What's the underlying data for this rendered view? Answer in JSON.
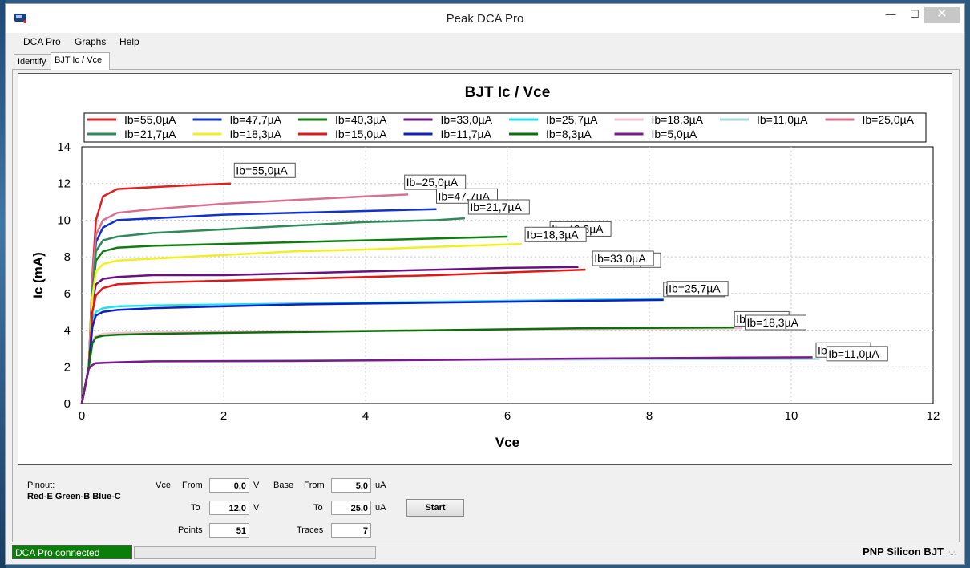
{
  "window": {
    "title": "Peak DCA Pro",
    "minimize": "—",
    "maximize": "☐",
    "close": "✕"
  },
  "menu": [
    "DCA Pro",
    "Graphs",
    "Help"
  ],
  "tabs": [
    {
      "label": "Identify"
    },
    {
      "label": "BJT Ic / Vce",
      "active": true
    }
  ],
  "chart_data": {
    "type": "line",
    "title": "BJT Ic / Vce",
    "xlabel": "Vce",
    "ylabel": "Ic (mA)",
    "xlim": [
      0,
      12
    ],
    "ylim": [
      0,
      14
    ],
    "xticks": [
      0,
      2,
      4,
      6,
      8,
      10,
      12
    ],
    "yticks": [
      0,
      2,
      4,
      6,
      8,
      10,
      12,
      14
    ],
    "grid": true,
    "legend_position": "top",
    "series": [
      {
        "name": "Ib=55,0µA",
        "color": "#e02020",
        "points": [
          [
            0,
            0
          ],
          [
            0.1,
            2.0
          ],
          [
            0.15,
            7.0
          ],
          [
            0.2,
            10.0
          ],
          [
            0.3,
            11.3
          ],
          [
            0.5,
            11.7
          ],
          [
            1.0,
            11.8
          ],
          [
            1.5,
            11.9
          ],
          [
            2.1,
            12.0
          ]
        ]
      },
      {
        "name": "Ib=47,7µA",
        "color": "#1030d0",
        "points": [
          [
            0,
            0
          ],
          [
            0.1,
            2.0
          ],
          [
            0.15,
            6.5
          ],
          [
            0.2,
            8.8
          ],
          [
            0.3,
            9.6
          ],
          [
            0.5,
            10.0
          ],
          [
            1,
            10.1
          ],
          [
            2,
            10.3
          ],
          [
            3,
            10.4
          ],
          [
            4,
            10.5
          ],
          [
            5,
            10.6
          ]
        ]
      },
      {
        "name": "Ib=40,3µA",
        "color": "#0e7d0e",
        "points": [
          [
            0,
            0
          ],
          [
            0.1,
            2.0
          ],
          [
            0.15,
            6.0
          ],
          [
            0.2,
            7.8
          ],
          [
            0.3,
            8.3
          ],
          [
            0.5,
            8.5
          ],
          [
            1,
            8.6
          ],
          [
            2,
            8.7
          ],
          [
            3,
            8.8
          ],
          [
            4,
            8.9
          ],
          [
            5,
            9.0
          ],
          [
            6,
            9.1
          ]
        ]
      },
      {
        "name": "Ib=33,0µA",
        "color": "#6a1080",
        "points": [
          [
            0,
            0
          ],
          [
            0.1,
            2.0
          ],
          [
            0.15,
            5.5
          ],
          [
            0.2,
            6.5
          ],
          [
            0.3,
            6.8
          ],
          [
            0.5,
            6.9
          ],
          [
            1,
            7.0
          ],
          [
            2,
            7.0
          ],
          [
            3,
            7.1
          ],
          [
            4,
            7.2
          ],
          [
            5,
            7.3
          ],
          [
            6,
            7.4
          ],
          [
            7,
            7.45
          ]
        ]
      },
      {
        "name": "Ib=25,7µA",
        "color": "#20e0f0",
        "points": [
          [
            0,
            0
          ],
          [
            0.1,
            2.0
          ],
          [
            0.15,
            4.6
          ],
          [
            0.2,
            5.0
          ],
          [
            0.3,
            5.2
          ],
          [
            0.5,
            5.3
          ],
          [
            1,
            5.35
          ],
          [
            2,
            5.4
          ],
          [
            3,
            5.45
          ],
          [
            4,
            5.5
          ],
          [
            5,
            5.55
          ],
          [
            6,
            5.6
          ],
          [
            7,
            5.65
          ],
          [
            8.2,
            5.7
          ]
        ]
      },
      {
        "name": "Ib=18,3µA",
        "color": "#f5c0d0",
        "points": [
          [
            0,
            0
          ],
          [
            0.1,
            2.0
          ],
          [
            0.15,
            3.4
          ],
          [
            0.2,
            3.7
          ],
          [
            0.3,
            3.8
          ],
          [
            0.5,
            3.85
          ],
          [
            1,
            3.9
          ],
          [
            3,
            3.95
          ],
          [
            5,
            4.0
          ],
          [
            7,
            4.05
          ],
          [
            9.3,
            4.1
          ]
        ]
      },
      {
        "name": "Ib=11,0µA",
        "color": "#a8d8d8",
        "points": [
          [
            0,
            0
          ],
          [
            0.1,
            1.9
          ],
          [
            0.15,
            2.1
          ],
          [
            0.2,
            2.2
          ],
          [
            0.5,
            2.25
          ],
          [
            1,
            2.3
          ],
          [
            3,
            2.35
          ],
          [
            5,
            2.38
          ],
          [
            7,
            2.4
          ],
          [
            9,
            2.42
          ],
          [
            10.4,
            2.43
          ]
        ]
      },
      {
        "name": "Ib=25,0µA",
        "color": "#d87090",
        "points": [
          [
            0,
            0
          ],
          [
            0.1,
            2.0
          ],
          [
            0.15,
            6.8
          ],
          [
            0.2,
            9.2
          ],
          [
            0.3,
            10.0
          ],
          [
            0.5,
            10.4
          ],
          [
            1,
            10.6
          ],
          [
            2,
            10.9
          ],
          [
            3,
            11.1
          ],
          [
            4,
            11.3
          ],
          [
            4.6,
            11.4
          ]
        ]
      },
      {
        "name": "Ib=21,7µA",
        "color": "#2e8a5a",
        "points": [
          [
            0,
            0
          ],
          [
            0.1,
            2.0
          ],
          [
            0.15,
            6.2
          ],
          [
            0.2,
            8.3
          ],
          [
            0.3,
            8.9
          ],
          [
            0.5,
            9.1
          ],
          [
            1,
            9.3
          ],
          [
            2,
            9.5
          ],
          [
            3,
            9.7
          ],
          [
            4,
            9.9
          ],
          [
            5,
            10.0
          ],
          [
            5.4,
            10.1
          ]
        ]
      },
      {
        "name": "Ib=18,3µA",
        "color": "#f0f020",
        "points": [
          [
            0,
            0
          ],
          [
            0.1,
            2.0
          ],
          [
            0.15,
            5.8
          ],
          [
            0.2,
            7.2
          ],
          [
            0.3,
            7.6
          ],
          [
            0.5,
            7.8
          ],
          [
            1,
            7.9
          ],
          [
            2,
            8.1
          ],
          [
            3,
            8.3
          ],
          [
            4,
            8.4
          ],
          [
            5,
            8.55
          ],
          [
            6.2,
            8.7
          ]
        ]
      },
      {
        "name": "Ib=15,0µA",
        "color": "#e01818",
        "points": [
          [
            0,
            0
          ],
          [
            0.1,
            2.0
          ],
          [
            0.15,
            5.0
          ],
          [
            0.2,
            5.9
          ],
          [
            0.3,
            6.3
          ],
          [
            0.5,
            6.5
          ],
          [
            1,
            6.6
          ],
          [
            2,
            6.7
          ],
          [
            3,
            6.8
          ],
          [
            4,
            6.9
          ],
          [
            5,
            7.0
          ],
          [
            6,
            7.15
          ],
          [
            7.1,
            7.3
          ]
        ]
      },
      {
        "name": "Ib=11,7µA",
        "color": "#1020c0",
        "points": [
          [
            0,
            0
          ],
          [
            0.1,
            2.0
          ],
          [
            0.15,
            4.2
          ],
          [
            0.2,
            4.8
          ],
          [
            0.3,
            5.0
          ],
          [
            0.5,
            5.1
          ],
          [
            1,
            5.2
          ],
          [
            2,
            5.3
          ],
          [
            3,
            5.4
          ],
          [
            4,
            5.45
          ],
          [
            5,
            5.5
          ],
          [
            6,
            5.55
          ],
          [
            7,
            5.6
          ],
          [
            8.2,
            5.65
          ]
        ]
      },
      {
        "name": "Ib=8,3µA",
        "color": "#0a700a",
        "points": [
          [
            0,
            0
          ],
          [
            0.1,
            2.0
          ],
          [
            0.15,
            3.3
          ],
          [
            0.2,
            3.6
          ],
          [
            0.3,
            3.7
          ],
          [
            0.5,
            3.75
          ],
          [
            1,
            3.8
          ],
          [
            3,
            3.9
          ],
          [
            5,
            4.0
          ],
          [
            7,
            4.1
          ],
          [
            9.2,
            4.15
          ]
        ]
      },
      {
        "name": "Ib=5,0µA",
        "color": "#7a1a8a",
        "points": [
          [
            0,
            0
          ],
          [
            0.1,
            1.9
          ],
          [
            0.15,
            2.1
          ],
          [
            0.2,
            2.2
          ],
          [
            0.5,
            2.25
          ],
          [
            1,
            2.3
          ],
          [
            3,
            2.32
          ],
          [
            5,
            2.38
          ],
          [
            7,
            2.45
          ],
          [
            9,
            2.5
          ],
          [
            10.3,
            2.52
          ]
        ]
      }
    ],
    "annotations": [
      {
        "text": "Ib=55,0µA",
        "x": 2.15,
        "y": 12.5
      },
      {
        "text": "Ib=25,0µA",
        "x": 4.55,
        "y": 11.85
      },
      {
        "text": "Ib=47,7µA",
        "x": 5.0,
        "y": 11.1
      },
      {
        "text": "Ib=21,7µA",
        "x": 5.45,
        "y": 10.5
      },
      {
        "text": "Ib=40,3µA",
        "x": 6.6,
        "y": 9.3
      },
      {
        "text": "Ib=18,3µA",
        "x": 6.25,
        "y": 9.0
      },
      {
        "text": "Ib=15,0µA",
        "x": 7.3,
        "y": 7.6
      },
      {
        "text": "Ib=33,0µA",
        "x": 7.2,
        "y": 7.7
      },
      {
        "text": "Ib=11,7µA",
        "x": 8.2,
        "y": 6.0
      },
      {
        "text": "Ib=25,7µA",
        "x": 8.25,
        "y": 6.05
      },
      {
        "text": "Ib=8,3µA",
        "x": 9.2,
        "y": 4.4
      },
      {
        "text": "Ib=18,3µA",
        "x": 9.35,
        "y": 4.2
      },
      {
        "text": "Ib=5,0µA",
        "x": 10.35,
        "y": 2.7
      },
      {
        "text": "Ib=11,0µA",
        "x": 10.5,
        "y": 2.5
      }
    ]
  },
  "controls": {
    "pinout_label": "Pinout:",
    "pinout_value": "Red-E Green-B Blue-C",
    "vce_label": "Vce",
    "base_label": "Base",
    "from_label": "From",
    "to_label": "To",
    "points_label": "Points",
    "traces_label": "Traces",
    "vce_from": "0,0",
    "vce_to": "12,0",
    "vce_unit": "V",
    "base_from": "5,0",
    "base_to": "25,0",
    "base_unit": "uA",
    "points": "51",
    "traces": "7",
    "start_button": "Start"
  },
  "status": {
    "connection": "DCA Pro connected",
    "device_type": "PNP Silicon BJT",
    "grip": "∴∴"
  }
}
